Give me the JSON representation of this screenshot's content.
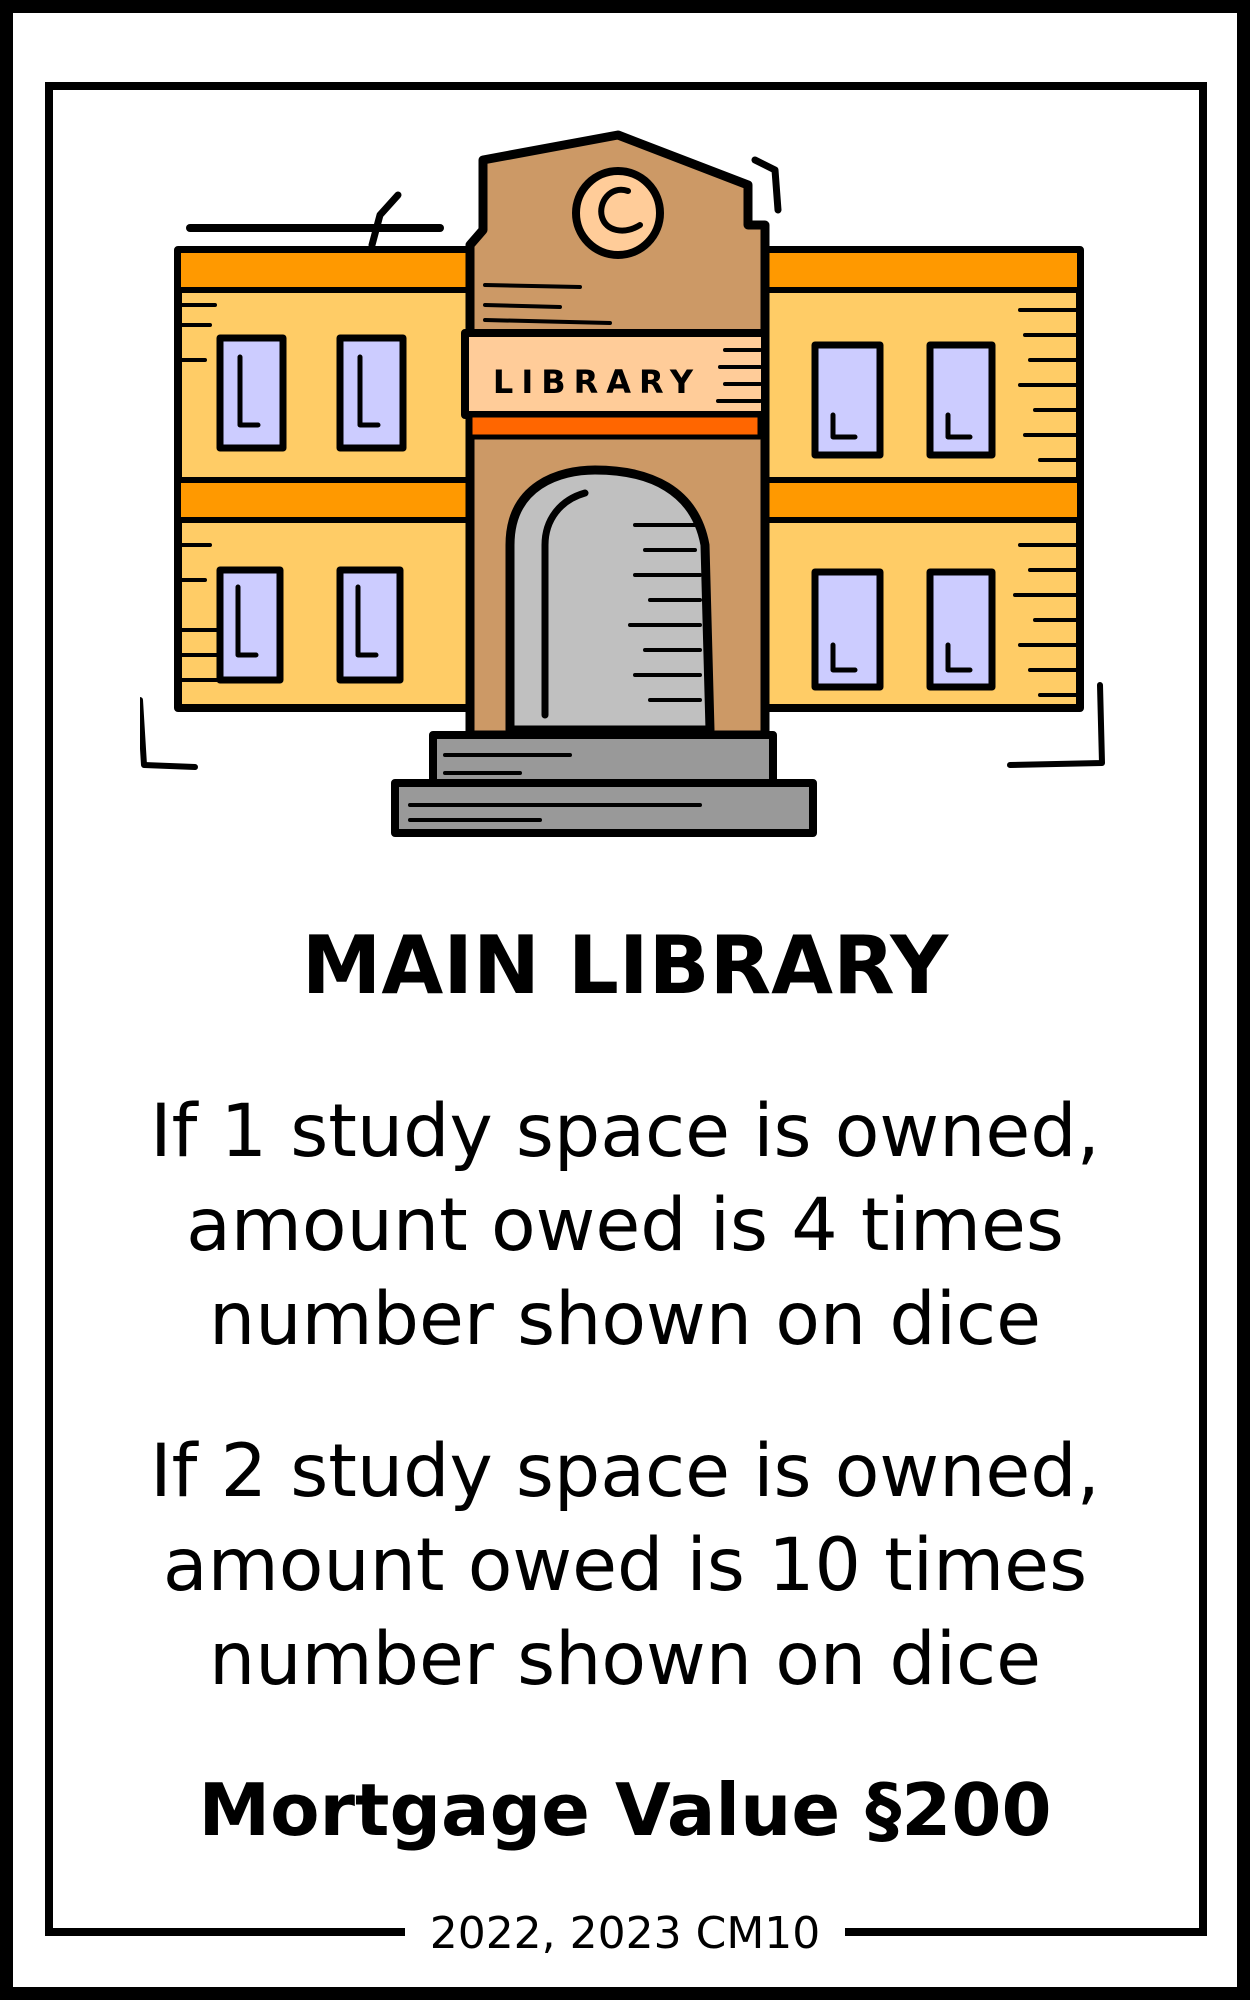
{
  "card": {
    "title": "MAIN LIBRARY",
    "illustration": {
      "icon": "library-building-icon",
      "sign_text": "LIBRARY",
      "colors": {
        "wall": "#FFCC66",
        "stripe": "#FF9900",
        "tower": "#CC9966",
        "sign": "#FFCC99",
        "window": "#CCCCFF",
        "door": "#C0C0C0",
        "steps": "#999999",
        "accent": "#FF6600"
      }
    },
    "rules": [
      {
        "lines": [
          "If 1 study space is owned,",
          "amount owed is 4 times",
          "number shown on dice"
        ]
      },
      {
        "lines": [
          "If 2 study space is owned,",
          "amount owed is 10 times",
          "number shown on dice"
        ]
      }
    ],
    "mortgage": "Mortgage Value §200",
    "footer": "2022, 2023 CM10"
  }
}
